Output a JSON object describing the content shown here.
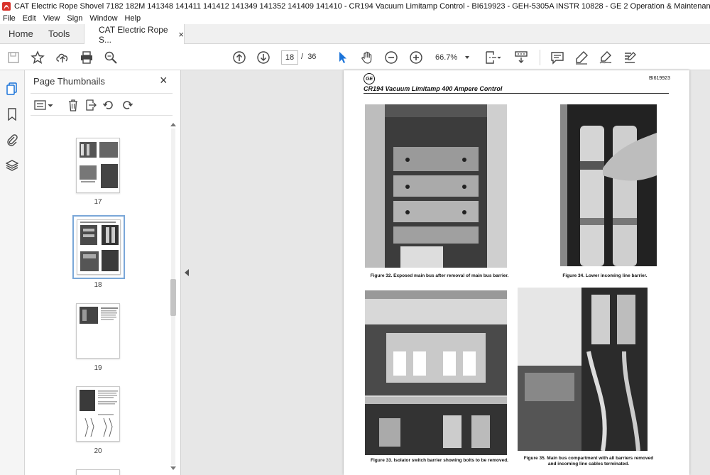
{
  "window": {
    "title": "CAT Electric Rope Shovel 7182 182M 141348 141411 141412 141349 141352 141409 141410 - CR194 Vacuum Limitamp Control - BI619923 - GEH-5305A INSTR 10828 - GE 2 Operation & Maintenance Manuals EN PDF.pdf - Adobe Acrobat Pro DC",
    "accent": "#d8322a"
  },
  "menu": [
    "File",
    "Edit",
    "View",
    "Sign",
    "Window",
    "Help"
  ],
  "tabs": {
    "home": "Home",
    "tools": "Tools",
    "document": "CAT Electric Rope S...",
    "close": "×"
  },
  "toolbar": {
    "current_page": "18",
    "page_separator": "/",
    "page_count": "36",
    "zoom": "66.7%"
  },
  "thumbnail_panel": {
    "title": "Page Thumbnails",
    "close": "×",
    "pages": [
      {
        "label": "17",
        "selected": false
      },
      {
        "label": "18",
        "selected": true
      },
      {
        "label": "19",
        "selected": false
      },
      {
        "label": "20",
        "selected": false
      }
    ]
  },
  "document": {
    "doc_code": "BI619923",
    "logo_text": "GE",
    "title": "CR194 Vacuum Limitamp 400 Ampere Control",
    "figures": [
      {
        "caption": "Figure 32.  Exposed main bus after removal of main bus barrier."
      },
      {
        "caption": "Figure 34.  Lower incoming line barrier."
      },
      {
        "caption": "Figure 33.  Isolator switch barrier showing bolts to be removed."
      },
      {
        "caption": "Figure 35.  Main bus compartment with all barriers removed and incoming line cables terminated."
      }
    ]
  }
}
